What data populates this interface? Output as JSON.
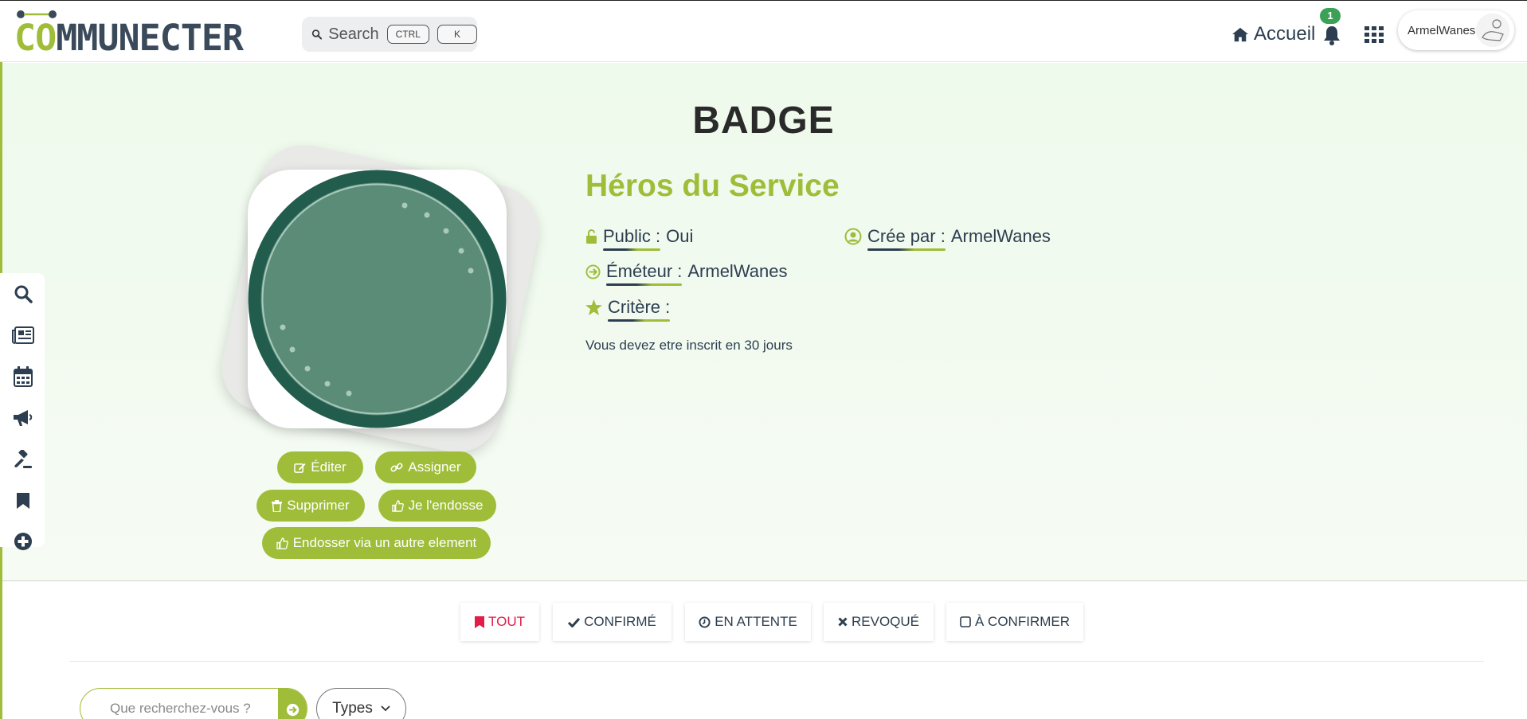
{
  "header": {
    "logo_prefix": "CO",
    "logo_rest": "MMUNECTER",
    "search_label": "Search",
    "kbd_ctrl": "CTRL",
    "kbd_k": "K",
    "home_label": "Accueil",
    "notifications_count": "1",
    "user_name": "ArmelWanes"
  },
  "page": {
    "title": "BADGE"
  },
  "badge": {
    "name": "Héros du Service",
    "public_key": "Public :",
    "public_value": "Oui",
    "creator_key": "Crée par :",
    "creator_value": "ArmelWanes",
    "issuer_key": "Éméteur :",
    "issuer_value": "ArmelWanes",
    "criteria_key": "Critère :",
    "description": "Vous devez etre inscrit en 30 jours",
    "colors": {
      "outer_ring": "#215c4d",
      "inner_fill": "#5a8c78",
      "accent": "#9fbd38"
    }
  },
  "actions": {
    "edit": "Éditer",
    "assign": "Assigner",
    "delete": "Supprimer",
    "endorse": "Je l'endosse",
    "endorse_other": "Endosser via un autre element"
  },
  "sidebar": {
    "items": [
      "search-icon",
      "news-icon",
      "calendar-icon",
      "megaphone-icon",
      "gavel-icon",
      "bookmark-icon",
      "add-icon"
    ]
  },
  "tabs": {
    "all": "TOUT",
    "confirmed": "CONFIRMÉ",
    "pending": "EN ATTENTE",
    "revoked": "REVOQUÉ",
    "to_confirm": "À CONFIRMER"
  },
  "filter": {
    "search_placeholder": "Que recherchez-vous ?",
    "types_label": "Types"
  }
}
